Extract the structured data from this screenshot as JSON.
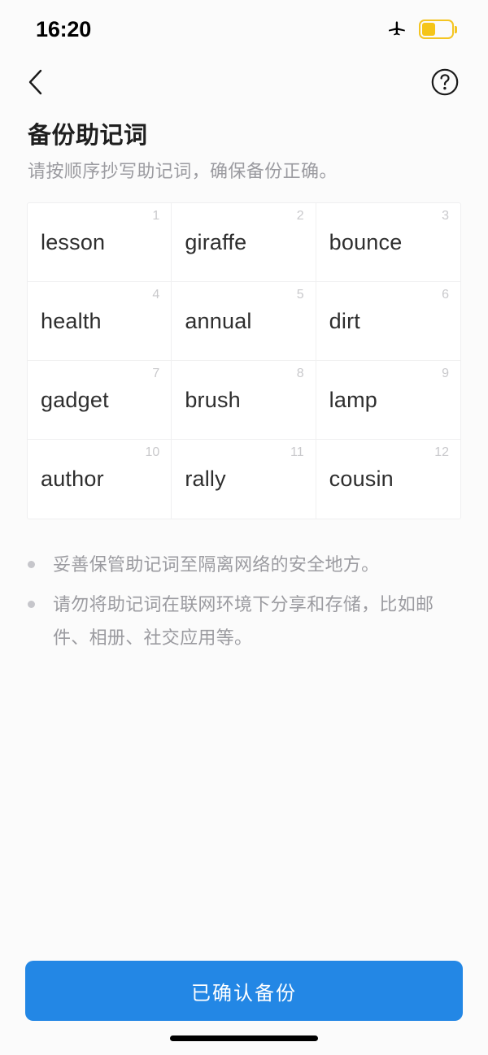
{
  "status_bar": {
    "time": "16:20",
    "airplane_icon": "airplane-mode-icon",
    "battery_icon": "battery-low-power-icon",
    "battery_level_percent": 45,
    "battery_color": "#f5c518"
  },
  "nav": {
    "back_icon": "chevron-left-icon",
    "help_icon": "question-circle-icon"
  },
  "header": {
    "title": "备份助记词",
    "subtitle": "请按顺序抄写助记词，确保备份正确。"
  },
  "mnemonic": {
    "words": [
      {
        "index": "1",
        "word": "lesson"
      },
      {
        "index": "2",
        "word": "giraffe"
      },
      {
        "index": "3",
        "word": "bounce"
      },
      {
        "index": "4",
        "word": "health"
      },
      {
        "index": "5",
        "word": "annual"
      },
      {
        "index": "6",
        "word": "dirt"
      },
      {
        "index": "7",
        "word": "gadget"
      },
      {
        "index": "8",
        "word": "brush"
      },
      {
        "index": "9",
        "word": "lamp"
      },
      {
        "index": "10",
        "word": "author"
      },
      {
        "index": "11",
        "word": "rally"
      },
      {
        "index": "12",
        "word": "cousin"
      }
    ]
  },
  "tips": [
    "妥善保管助记词至隔离网络的安全地方。",
    "请勿将助记词在联网环境下分享和存储，比如邮件、相册、社交应用等。"
  ],
  "footer": {
    "confirm_label": "已确认备份",
    "accent_color": "#2387e5"
  }
}
